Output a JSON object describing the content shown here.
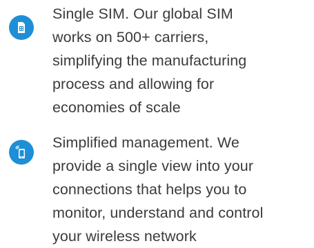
{
  "features": [
    {
      "icon": "sim-card-icon",
      "lines": [
        "Single SIM. Our global SIM",
        "works on 500+ carriers,",
        "simplifying the manufacturing",
        "process and allowing for",
        "economies of scale"
      ]
    },
    {
      "icon": "mobile-signal-icon",
      "lines": [
        "Simplified management. We",
        "provide a single view into your",
        "connections that helps you to",
        "monitor, understand and control",
        "your wireless network"
      ]
    }
  ],
  "colors": {
    "icon_badge": "#1e8fd6",
    "text": "#3b3b3b",
    "background": "#ffffff"
  }
}
